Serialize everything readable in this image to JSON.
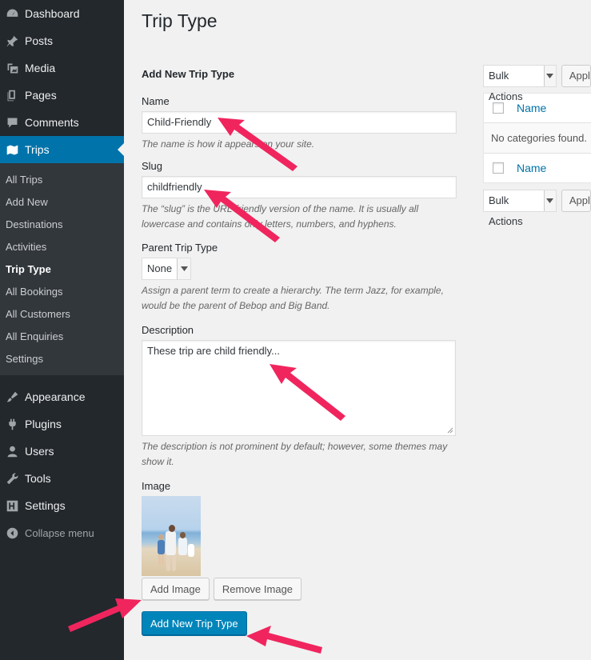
{
  "sidebar": {
    "top_items": [
      {
        "label": "Dashboard",
        "icon": "dashboard-icon"
      },
      {
        "label": "Posts",
        "icon": "pin-icon"
      },
      {
        "label": "Media",
        "icon": "media-icon"
      },
      {
        "label": "Pages",
        "icon": "pages-icon"
      },
      {
        "label": "Comments",
        "icon": "comment-icon"
      },
      {
        "label": "Trips",
        "icon": "map-icon"
      }
    ],
    "sub_items": [
      "All Trips",
      "Add New",
      "Destinations",
      "Activities",
      "Trip Type",
      "All Bookings",
      "All Customers",
      "All Enquiries",
      "Settings"
    ],
    "current_sub": "Trip Type",
    "bottom_items": [
      {
        "label": "Appearance",
        "icon": "paintbrush-icon"
      },
      {
        "label": "Plugins",
        "icon": "plugin-icon"
      },
      {
        "label": "Users",
        "icon": "user-icon"
      },
      {
        "label": "Tools",
        "icon": "wrench-icon"
      },
      {
        "label": "Settings",
        "icon": "settings-icon"
      }
    ],
    "collapse_label": "Collapse menu"
  },
  "page": {
    "title": "Trip Type"
  },
  "form": {
    "heading": "Add New Trip Type",
    "name_label": "Name",
    "name_value": "Child-Friendly",
    "name_help": "The name is how it appears on your site.",
    "slug_label": "Slug",
    "slug_value": "childfriendly",
    "slug_help": "The “slug” is the URL-friendly version of the name. It is usually all lowercase and contains only letters, numbers, and hyphens.",
    "parent_label": "Parent Trip Type",
    "parent_value": "None",
    "parent_help": "Assign a parent term to create a hierarchy. The term Jazz, for example, would be the parent of Bebop and Big Band.",
    "description_label": "Description",
    "description_value": "These trip are child friendly...",
    "description_help": "The description is not prominent by default; however, some themes may show it.",
    "image_label": "Image",
    "add_image_button": "Add Image",
    "remove_image_button": "Remove Image",
    "submit_button": "Add New Trip Type"
  },
  "list": {
    "bulk_actions_label": "Bulk Actions",
    "apply_button": "Apply",
    "column_name": "Name",
    "empty_message": "No categories found."
  },
  "colors": {
    "sidebar_bg": "#23282d",
    "accent": "#0073aa",
    "primary_button": "#0085ba",
    "annotation_arrow": "#f0255e"
  }
}
